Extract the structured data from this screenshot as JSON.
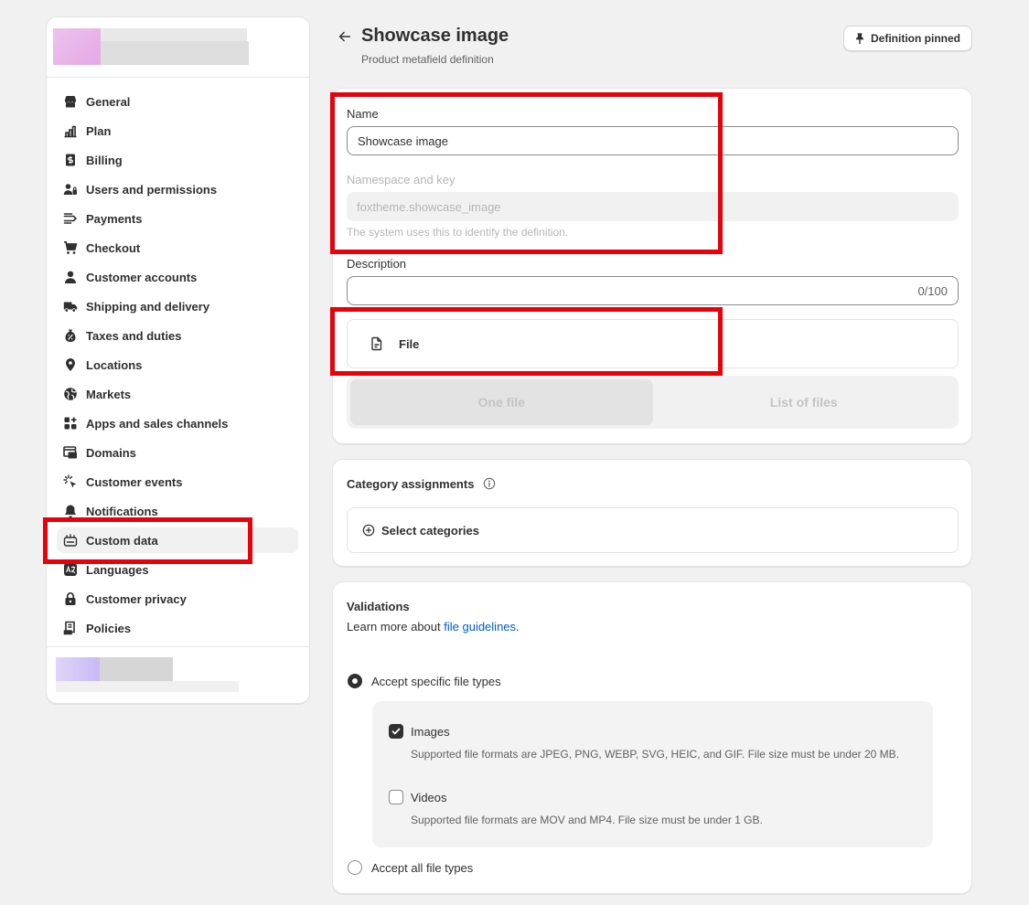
{
  "sidebar": {
    "items": [
      {
        "label": "General",
        "icon": "store-icon"
      },
      {
        "label": "Plan",
        "icon": "plan-icon"
      },
      {
        "label": "Billing",
        "icon": "billing-icon"
      },
      {
        "label": "Users and permissions",
        "icon": "users-icon"
      },
      {
        "label": "Payments",
        "icon": "payments-icon"
      },
      {
        "label": "Checkout",
        "icon": "cart-icon"
      },
      {
        "label": "Customer accounts",
        "icon": "person-icon"
      },
      {
        "label": "Shipping and delivery",
        "icon": "truck-icon"
      },
      {
        "label": "Taxes and duties",
        "icon": "tax-icon"
      },
      {
        "label": "Locations",
        "icon": "location-icon"
      },
      {
        "label": "Markets",
        "icon": "globe-icon"
      },
      {
        "label": "Apps and sales channels",
        "icon": "apps-icon"
      },
      {
        "label": "Domains",
        "icon": "domains-icon"
      },
      {
        "label": "Customer events",
        "icon": "cursor-icon"
      },
      {
        "label": "Notifications",
        "icon": "bell-icon"
      },
      {
        "label": "Custom data",
        "icon": "custom-data-icon",
        "active": true
      },
      {
        "label": "Languages",
        "icon": "languages-icon"
      },
      {
        "label": "Customer privacy",
        "icon": "lock-icon"
      },
      {
        "label": "Policies",
        "icon": "policies-icon"
      }
    ]
  },
  "header": {
    "title": "Showcase image",
    "subtitle": "Product metafield definition",
    "pin_label": "Definition pinned"
  },
  "definition": {
    "name_label": "Name",
    "name_value": "Showcase image",
    "namespace_label": "Namespace and key",
    "namespace_value": "foxtheme.showcase_image",
    "namespace_help": "The system uses this to identify the definition.",
    "description_label": "Description",
    "description_value": "",
    "description_counter": "0/100",
    "type_label": "File",
    "segments": [
      "One file",
      "List of files"
    ]
  },
  "categories": {
    "title": "Category assignments",
    "select_label": "Select categories"
  },
  "validations": {
    "title": "Validations",
    "learn_prefix": "Learn more about",
    "learn_link": "file guidelines",
    "learn_suffix": ".",
    "accept_specific": "Accept specific file types",
    "images_label": "Images",
    "images_help": "Supported file formats are JPEG, PNG, WEBP, SVG, HEIC, and GIF. File size must be under 20 MB.",
    "videos_label": "Videos",
    "videos_help": "Supported file formats are MOV and MP4. File size must be under 1 GB.",
    "accept_all": "Accept all file types"
  },
  "colors": {
    "annotation": "#e8000b",
    "link": "#005bd3",
    "background": "#f1f1f1"
  }
}
